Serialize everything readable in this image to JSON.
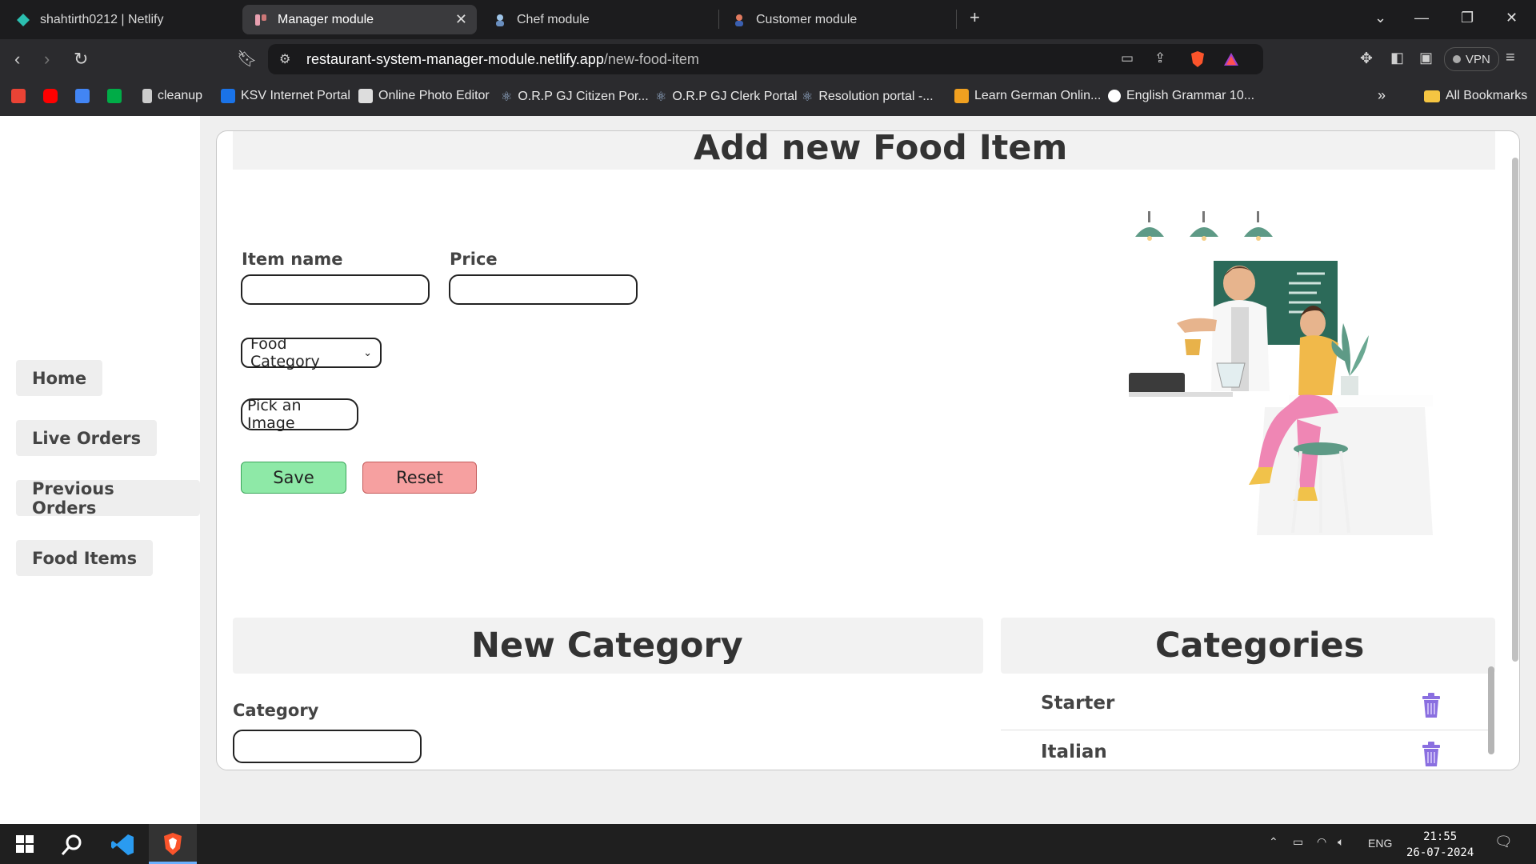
{
  "browser": {
    "tabs": [
      {
        "label": "shahtirth0212 | Netlify",
        "icon": "netlify-icon"
      },
      {
        "label": "Manager module",
        "icon": "manager-favicon-icon",
        "active": true
      },
      {
        "label": "Chef module",
        "icon": "chef-favicon-icon"
      },
      {
        "label": "Customer module",
        "icon": "customer-favicon-icon"
      }
    ],
    "url_host": "restaurant-system-manager-module.netlify.app",
    "url_path": "/new-food-item",
    "vpn_label": "VPN",
    "bookmarks": [
      "cleanup",
      "KSV Internet Portal",
      "Online Photo Editor",
      "O.R.P GJ Citizen Por...",
      "O.R.P GJ Clerk Portal",
      "Resolution portal -...",
      "Learn German Onlin...",
      "English Grammar 10..."
    ],
    "all_bookmarks": "All Bookmarks"
  },
  "sidebar": {
    "items": [
      "Home",
      "Live Orders",
      "Previous Orders",
      "Food Items"
    ]
  },
  "form": {
    "title": "Add new Food Item",
    "item_name_label": "Item name",
    "price_label": "Price",
    "category_select": "Food Category",
    "pick_image": "Pick an Image",
    "save": "Save",
    "reset": "Reset"
  },
  "new_category": {
    "title": "New Category",
    "category_label": "Category"
  },
  "categories": {
    "title": "Categories",
    "items": [
      "Starter",
      "Italian"
    ]
  },
  "taskbar": {
    "lang": "ENG",
    "time": "21:55",
    "date": "26-07-2024"
  },
  "colors": {
    "save_bg": "#8ee9a7",
    "reset_bg": "#f6a0a0",
    "trash": "#8a6fe0"
  }
}
